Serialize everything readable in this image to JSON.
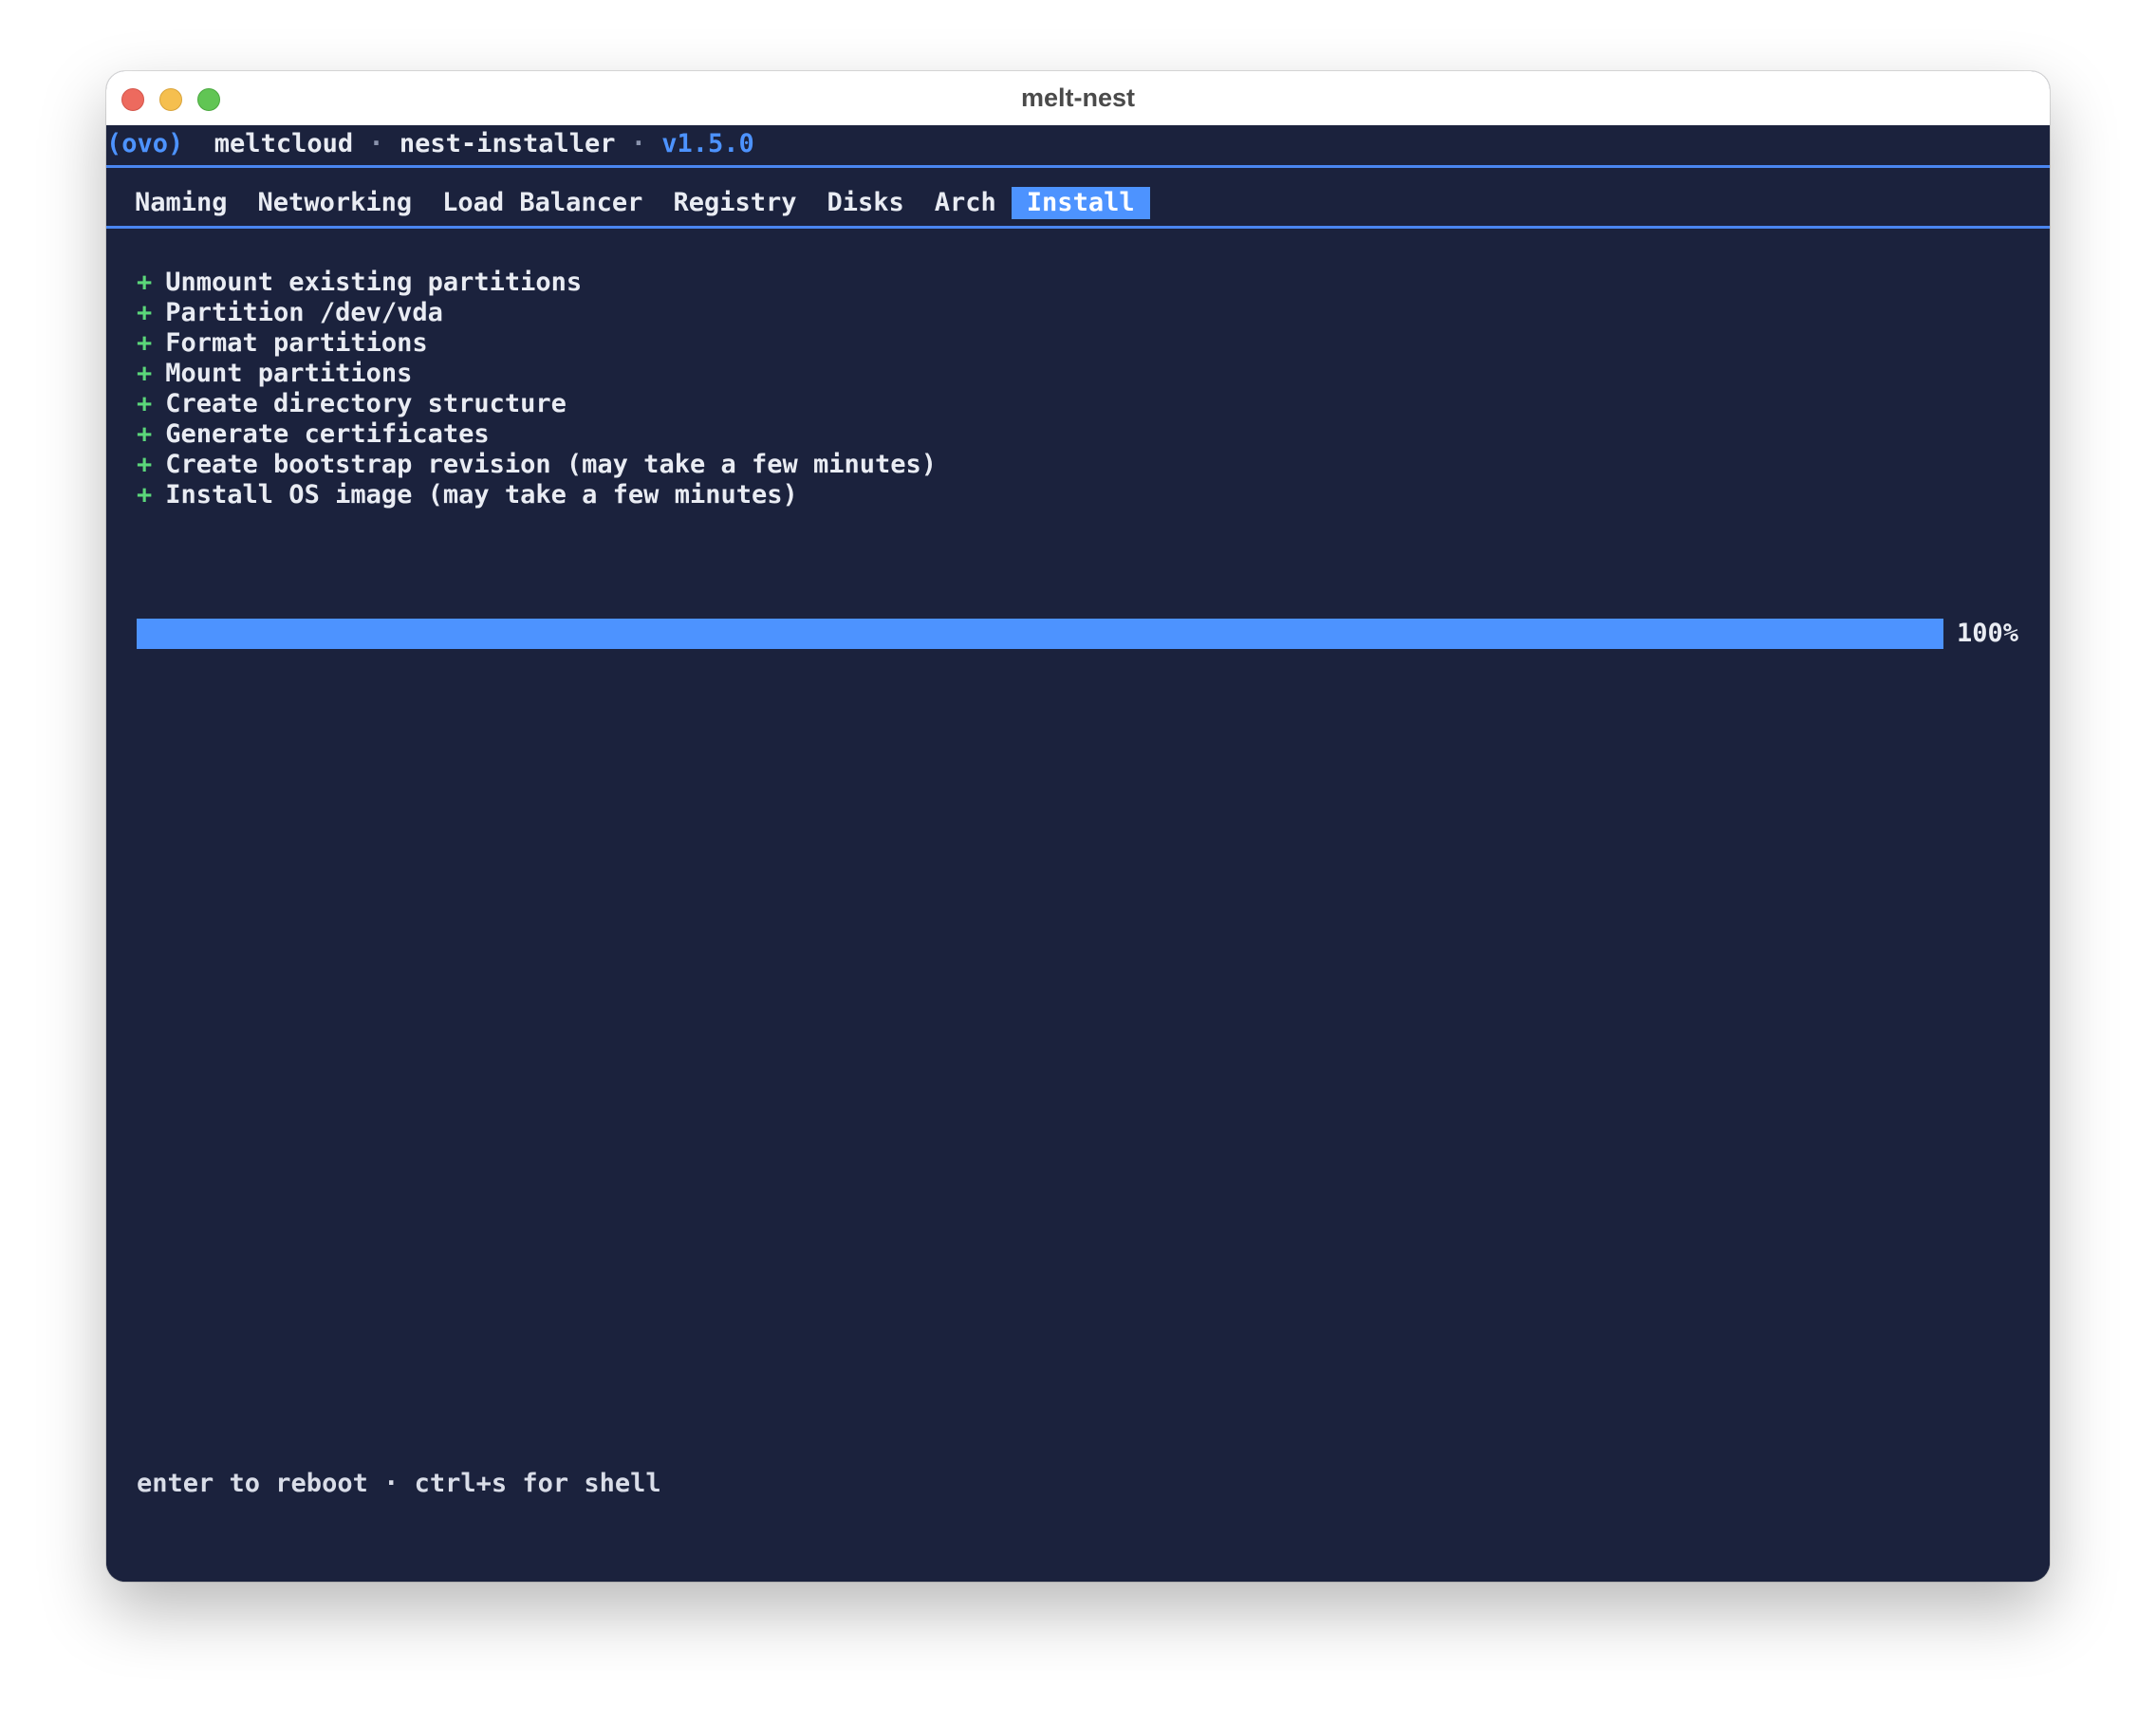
{
  "window": {
    "title": "melt-nest"
  },
  "header": {
    "logo": "(ovo)",
    "brand": "meltcloud",
    "separator": "·",
    "app": "nest-installer",
    "version": "v1.5.0"
  },
  "tabs": [
    {
      "label": "Naming",
      "active": false
    },
    {
      "label": "Networking",
      "active": false
    },
    {
      "label": "Load Balancer",
      "active": false
    },
    {
      "label": "Registry",
      "active": false
    },
    {
      "label": "Disks",
      "active": false
    },
    {
      "label": "Arch",
      "active": false
    },
    {
      "label": "Install",
      "active": true
    }
  ],
  "steps": [
    {
      "marker": "+",
      "label": "Unmount existing partitions"
    },
    {
      "marker": "+",
      "label": "Partition /dev/vda"
    },
    {
      "marker": "+",
      "label": "Format partitions"
    },
    {
      "marker": "+",
      "label": "Mount partitions"
    },
    {
      "marker": "+",
      "label": "Create directory structure"
    },
    {
      "marker": "+",
      "label": "Generate certificates"
    },
    {
      "marker": "+",
      "label": "Create bootstrap revision (may take a few minutes)"
    },
    {
      "marker": "+",
      "label": "Install OS image (may take a few minutes)"
    }
  ],
  "progress": {
    "value": 1.0,
    "label": "100%"
  },
  "footer": {
    "hint": "enter to reboot · ctrl+s for shell"
  },
  "colors": {
    "background": "#1b223d",
    "accent": "#4d93ff",
    "success": "#5bd77a",
    "text": "#e9ecf3"
  }
}
